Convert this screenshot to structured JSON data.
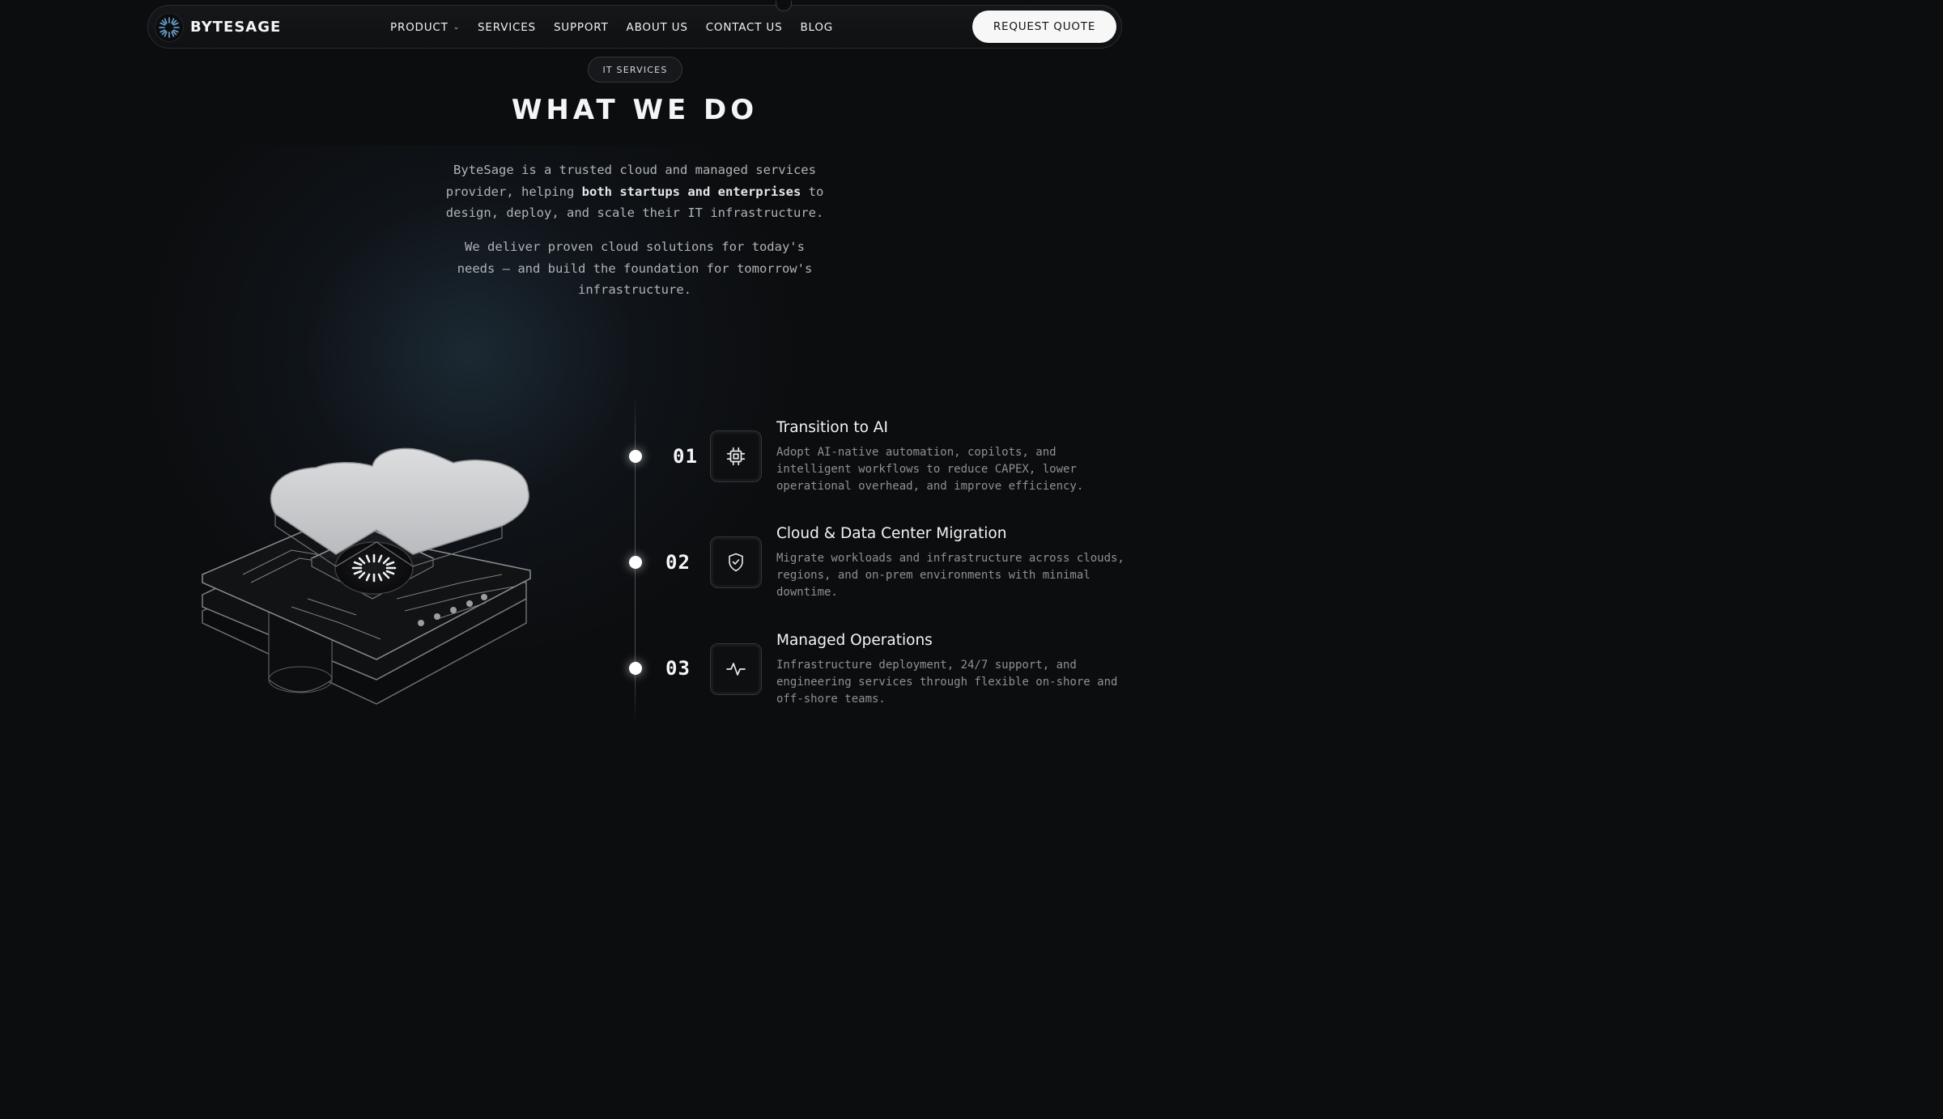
{
  "nav": {
    "brand": "BYTESAGE",
    "items": [
      {
        "label": "PRODUCT",
        "has_dropdown": true
      },
      {
        "label": "SERVICES"
      },
      {
        "label": "SUPPORT"
      },
      {
        "label": "ABOUT US"
      },
      {
        "label": "CONTACT US"
      },
      {
        "label": "BLOG"
      }
    ],
    "cta": "REQUEST QUOTE"
  },
  "section": {
    "eyebrow": "IT SERVICES",
    "title": "WHAT WE DO",
    "intro_before": "ByteSage is a trusted cloud and managed services provider, helping ",
    "intro_bold": "both startups and enterprises",
    "intro_after": " to design, deploy, and scale their IT infrastructure.",
    "tagline": "We deliver proven cloud solutions for today's needs — and build the foundation for tomorrow's infrastructure."
  },
  "services": [
    {
      "number": "01",
      "icon": "cpu-icon",
      "title": "Transition to AI",
      "description": "Adopt AI-native automation, copilots, and intelligent workflows to reduce CAPEX, lower operational overhead, and improve efficiency."
    },
    {
      "number": "02",
      "icon": "shield-check-icon",
      "title": "Cloud & Data Center Migration",
      "description": "Migrate workloads and infrastructure across clouds, regions, and on-prem environments with minimal downtime."
    },
    {
      "number": "03",
      "icon": "activity-pulse-icon",
      "title": "Managed Operations",
      "description": "Infrastructure deployment, 24/7 support, and engineering services through flexible on-shore and off-shore teams."
    }
  ],
  "colors": {
    "background": "#0c0d0f",
    "accent_logo": "#6fa8d8",
    "button_bg": "#f7f7f8"
  }
}
